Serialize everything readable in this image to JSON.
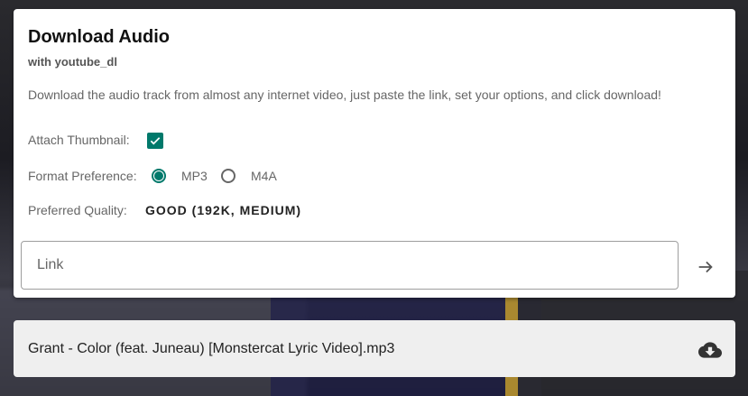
{
  "card": {
    "title": "Download Audio",
    "subtitle": "with youtube_dl",
    "description": "Download the audio track from almost any internet video, just paste the link, set your options, and click download!"
  },
  "options": {
    "thumbnail_label": "Attach Thumbnail:",
    "thumbnail_checked": true,
    "format_label": "Format Preference:",
    "formats": [
      "MP3",
      "M4A"
    ],
    "format_selected": "MP3",
    "quality_label": "Preferred Quality:",
    "quality_value": "GOOD (192K, MEDIUM)"
  },
  "link": {
    "placeholder": "Link",
    "value": ""
  },
  "download": {
    "file_name": "Grant - Color (feat. Juneau) [Monstercat Lyric Video].mp3"
  },
  "colors": {
    "accent": "#00796b"
  },
  "icons": {
    "submit": "arrow-right-icon",
    "download": "cloud-download-icon",
    "checkbox": "check-icon"
  }
}
